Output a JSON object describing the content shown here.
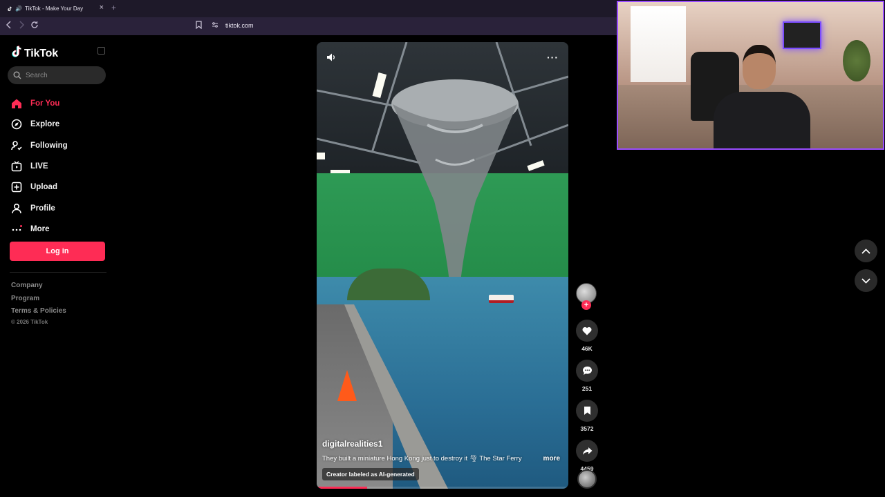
{
  "browser": {
    "tab_title": "TikTok - Make Your Day",
    "new_tab": "+",
    "url": "tiktok.com",
    "close_glyph": "×"
  },
  "sidebar": {
    "logo": "TikTok",
    "search_placeholder": "Search",
    "nav": [
      {
        "label": "For You",
        "icon": "home-icon",
        "active": true
      },
      {
        "label": "Explore",
        "icon": "compass-icon",
        "active": false
      },
      {
        "label": "Following",
        "icon": "user-follow-icon",
        "active": false
      },
      {
        "label": "LIVE",
        "icon": "live-tv-icon",
        "active": false
      },
      {
        "label": "Upload",
        "icon": "plus-square-icon",
        "active": false
      },
      {
        "label": "Profile",
        "icon": "person-icon",
        "active": false
      },
      {
        "label": "More",
        "icon": "more-dots-icon",
        "active": false
      }
    ],
    "login_label": "Log in",
    "footer_links": [
      "Company",
      "Program",
      "Terms & Policies"
    ],
    "copyright": "© 2026 TikTok"
  },
  "video": {
    "author": "digitalrealities1",
    "caption": "They built a miniature Hong Kong just to destroy it 🌪 The Star Ferry",
    "more_label": "more",
    "ai_label": "Creator labeled as AI-generated",
    "more_glyph": "···",
    "progress": 0.2
  },
  "actions": {
    "follow_glyph": "+",
    "likes": "46K",
    "comments": "251",
    "saves": "3572",
    "shares": "4459"
  },
  "colors": {
    "accent": "#fe2c55",
    "webcam_border": "#9a4dff"
  }
}
